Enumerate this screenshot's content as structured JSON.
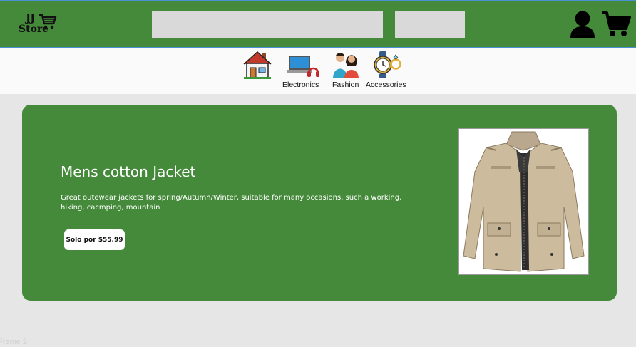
{
  "header": {
    "logo_line1": "JJ",
    "logo_line2": "Store",
    "search_placeholder": "",
    "search_button_label": "",
    "user_icon": "user-icon",
    "cart_icon": "cart-icon"
  },
  "categories": [
    {
      "label": "",
      "icon": "house-icon"
    },
    {
      "label": "Electronics",
      "icon": "laptop-icon"
    },
    {
      "label": "Fashion",
      "icon": "people-icon"
    },
    {
      "label": "Accessories",
      "icon": "watch-ring-icon"
    }
  ],
  "hero": {
    "title": "Mens cotton Jacket",
    "description": "Great outewear jackets for spring/Autumn/Winter, suitable for many occasions, such a working, hiking, cacmping, mountain",
    "price_label": "Solo por $55.99",
    "image_icon": "jacket-image"
  },
  "frame_label": "Frame 2",
  "colors": {
    "primary_green": "#458a3a",
    "accent_blue": "#4a8fd0",
    "input_gray": "#d9d9d9",
    "page_background": "#e6e6e6",
    "category_bar": "#fafafa"
  }
}
